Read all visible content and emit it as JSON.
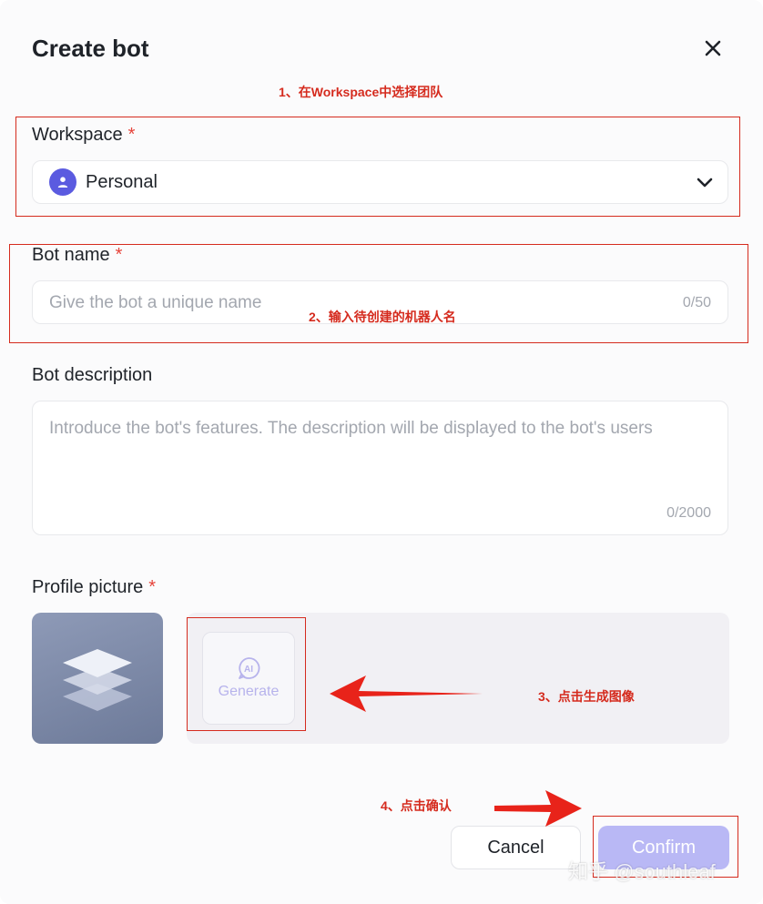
{
  "dialog": {
    "title": "Create bot"
  },
  "workspace": {
    "label": "Workspace",
    "required_mark": "*",
    "selected_value": "Personal"
  },
  "bot_name": {
    "label": "Bot name",
    "required_mark": "*",
    "placeholder": "Give the bot a unique name",
    "counter": "0/50"
  },
  "bot_description": {
    "label": "Bot description",
    "placeholder": "Introduce the bot's features. The description will be displayed to the bot's users",
    "counter": "0/2000"
  },
  "profile_picture": {
    "label": "Profile picture",
    "required_mark": "*",
    "generate_label": "Generate",
    "ai_badge": "AI"
  },
  "footer": {
    "cancel_label": "Cancel",
    "confirm_label": "Confirm"
  },
  "annotations": {
    "step1": "1、在Workspace中选择团队",
    "step2": "2、输入待创建的机器人名",
    "step3": "3、点击生成图像",
    "step4": "4、点击确认",
    "watermark": "知乎 @southleaf"
  },
  "colors": {
    "accent": "#5b5be0",
    "confirm_disabled": "#b9b8f5",
    "required": "#e6433a",
    "annotation": "#d52b1e"
  }
}
